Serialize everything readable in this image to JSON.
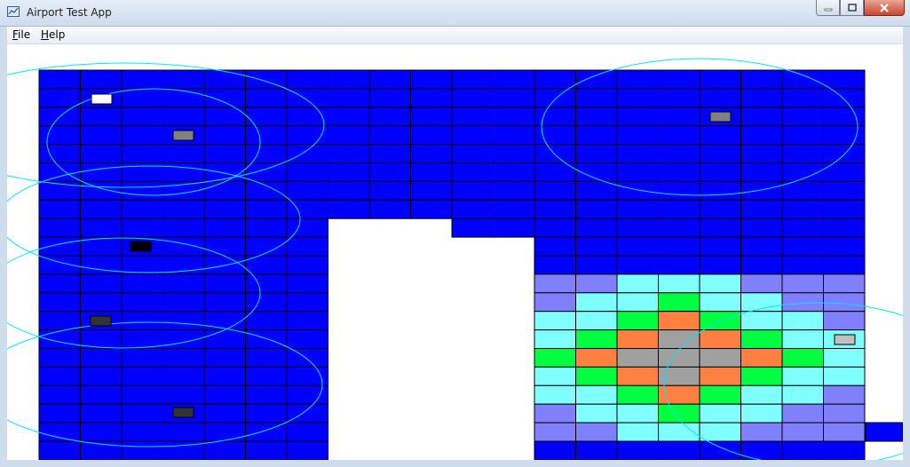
{
  "window": {
    "title": "Airport Test App",
    "app_icon": "envelope-chart-icon"
  },
  "window_buttons": {
    "minimize_icon": "minimize-icon",
    "maximize_icon": "maximize-icon",
    "close_icon": "close-icon"
  },
  "menu": {
    "items": [
      {
        "mnemonic": "F",
        "rest": "ile"
      },
      {
        "mnemonic": "H",
        "rest": "elp"
      }
    ]
  },
  "colors": {
    "floor": "#0000ff",
    "grid_line": "#000000",
    "coverage_ring": "#00e5ff",
    "ap_white": "#ffffff",
    "ap_grey": "#808080",
    "ap_black": "#000000",
    "ap_dark": "#333333",
    "ap_light": "#c0c0c0",
    "heat_level_0": "#8080ff",
    "heat_level_1": "#80ffff",
    "heat_level_2": "#00ff40",
    "heat_level_3": "#ff8040",
    "heat_level_4": "#a0a0a0"
  },
  "floorplan": {
    "grid": {
      "cols": 20,
      "rows": 21
    },
    "heatmap_levels": [
      [
        0,
        0,
        1,
        1,
        1,
        0,
        0,
        0
      ],
      [
        0,
        1,
        1,
        2,
        1,
        1,
        0,
        0
      ],
      [
        1,
        1,
        2,
        3,
        2,
        1,
        1,
        0
      ],
      [
        1,
        2,
        3,
        4,
        3,
        2,
        1,
        1
      ],
      [
        2,
        3,
        4,
        4,
        4,
        3,
        2,
        1
      ],
      [
        1,
        2,
        3,
        4,
        3,
        2,
        1,
        1
      ],
      [
        1,
        1,
        2,
        3,
        2,
        1,
        1,
        0
      ],
      [
        0,
        1,
        1,
        2,
        1,
        1,
        0,
        0
      ],
      [
        0,
        0,
        1,
        1,
        1,
        0,
        0,
        0
      ]
    ],
    "access_points": [
      {
        "name": "ap-white",
        "color": "ap_white"
      },
      {
        "name": "ap-grey-1",
        "color": "ap_grey"
      },
      {
        "name": "ap-black",
        "color": "ap_black"
      },
      {
        "name": "ap-dark-1",
        "color": "ap_dark"
      },
      {
        "name": "ap-dark-2",
        "color": "ap_dark"
      },
      {
        "name": "ap-grey-2",
        "color": "ap_grey"
      },
      {
        "name": "ap-light",
        "color": "ap_light"
      }
    ]
  }
}
